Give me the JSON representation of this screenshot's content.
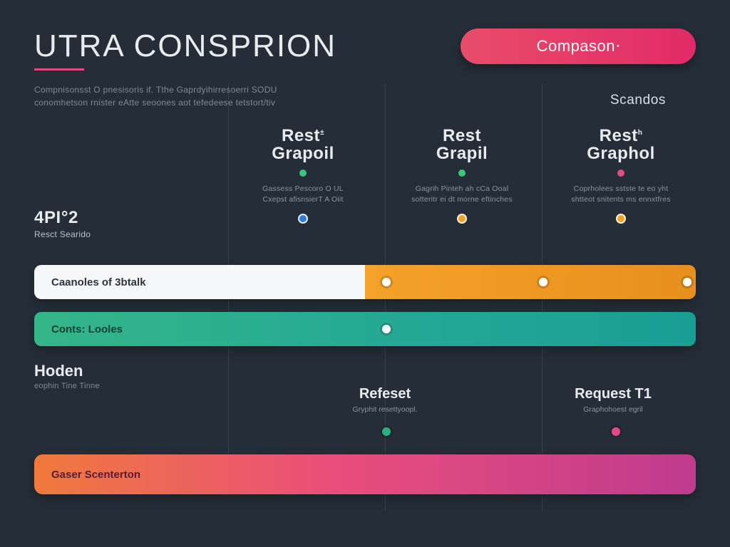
{
  "header": {
    "title": "UTRA CONSPRION",
    "subtitle_line1": "Compnisonsst O pnesisoris if. Tthe Gaprdyihirresoerri SODU",
    "subtitle_line2": "conomhetson rnister eAtte seoones aot tefedeese tetstort/tiv"
  },
  "badge": {
    "label": "Compason",
    "sup": "•"
  },
  "scandos": "Scandos",
  "columns": [
    {
      "title_top": "Rest",
      "title_sup": "±",
      "title_bottom": "Grapoil",
      "dot_color": "#38c67a",
      "desc_line1": "Gassess Pescoro O UL",
      "desc_line2": "Cxepst afisnsierT A Oiit",
      "minidot_color": "#2f7bdc"
    },
    {
      "title_top": "Rest",
      "title_sup": "",
      "title_bottom": "Grapil",
      "dot_color": "#38c67a",
      "desc_line1": "Gagrih Pinteh ah cCa Ooal",
      "desc_line2": "sotteritr ei dt morne eftinches",
      "minidot_color": "#f4a22a"
    },
    {
      "title_top": "Rest",
      "title_sup": "h",
      "title_bottom": "Graphol",
      "dot_color": "#e24b82",
      "desc_line1": "Coprholees sstste te eo yht",
      "desc_line2": "shtteot snitents ms ennxtfres",
      "minidot_color": "#f4a22a"
    }
  ],
  "left_section": {
    "title": "4PI°2",
    "subtitle": "Resct Searido"
  },
  "rows": {
    "r1_label": "Caanoles of 3btalk",
    "r2_label": "Conts: Looles",
    "r3_label": "Gaser Scenterton"
  },
  "section2": {
    "title": "Hoden",
    "subtitle": "eophin Tine Tinne"
  },
  "midlabels": {
    "a_title": "Refeset",
    "a_sub": "Gryphit resettyoopl.",
    "b_title": "Request T1",
    "b_sub": "Graphohoest egril"
  },
  "colors": {
    "accent_pink": "#e24b82",
    "green": "#34b688",
    "orange": "#f4a22a",
    "blue": "#2f7bdc"
  }
}
